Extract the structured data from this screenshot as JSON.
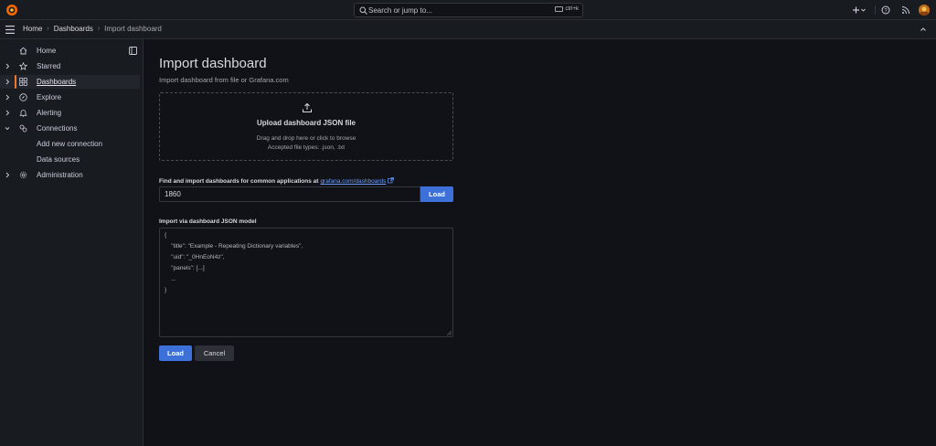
{
  "search": {
    "placeholder": "Search or jump to...",
    "shortcut": "ctrl+k"
  },
  "topbar": {
    "icons": [
      "plus-icon",
      "chevron-down-icon",
      "help-icon",
      "rss-icon",
      "avatar"
    ]
  },
  "breadcrumb": {
    "home": "Home",
    "dashboards": "Dashboards",
    "current": "Import dashboard"
  },
  "sidebar": {
    "items": [
      {
        "label": "Home",
        "icon": "home-icon"
      },
      {
        "label": "Starred",
        "icon": "star-icon"
      },
      {
        "label": "Dashboards",
        "icon": "apps-icon"
      },
      {
        "label": "Explore",
        "icon": "compass-icon"
      },
      {
        "label": "Alerting",
        "icon": "bell-icon"
      },
      {
        "label": "Connections",
        "icon": "link-icon"
      },
      {
        "label": "Add new connection"
      },
      {
        "label": "Data sources"
      },
      {
        "label": "Administration",
        "icon": "cog-icon"
      }
    ]
  },
  "main": {
    "title": "Import dashboard",
    "subtitle": "Import dashboard from file or Grafana.com",
    "upload": {
      "title": "Upload dashboard JSON file",
      "hint": "Drag and drop here or click to browse",
      "types": "Accepted file types: .json, .txt"
    },
    "grafana_com": {
      "label": "Find and import dashboards for common applications at",
      "link": "grafana.com/dashboards",
      "value": "1860",
      "button": "Load"
    },
    "json_model": {
      "label": "Import via dashboard JSON model",
      "lines": [
        "{",
        "    \"title\": \"Example - Repeating Dictionary variables\",",
        "    \"uid\": \"_0HnEoN4z\",",
        "    \"panels\": [...]",
        "    ...",
        "}"
      ]
    },
    "actions": {
      "load": "Load",
      "cancel": "Cancel"
    }
  },
  "colors": {
    "accent": "#3d71d9",
    "active_bar": "#f0792a",
    "link": "#6e9fff",
    "background": "#111217",
    "panel": "#181b1f"
  }
}
